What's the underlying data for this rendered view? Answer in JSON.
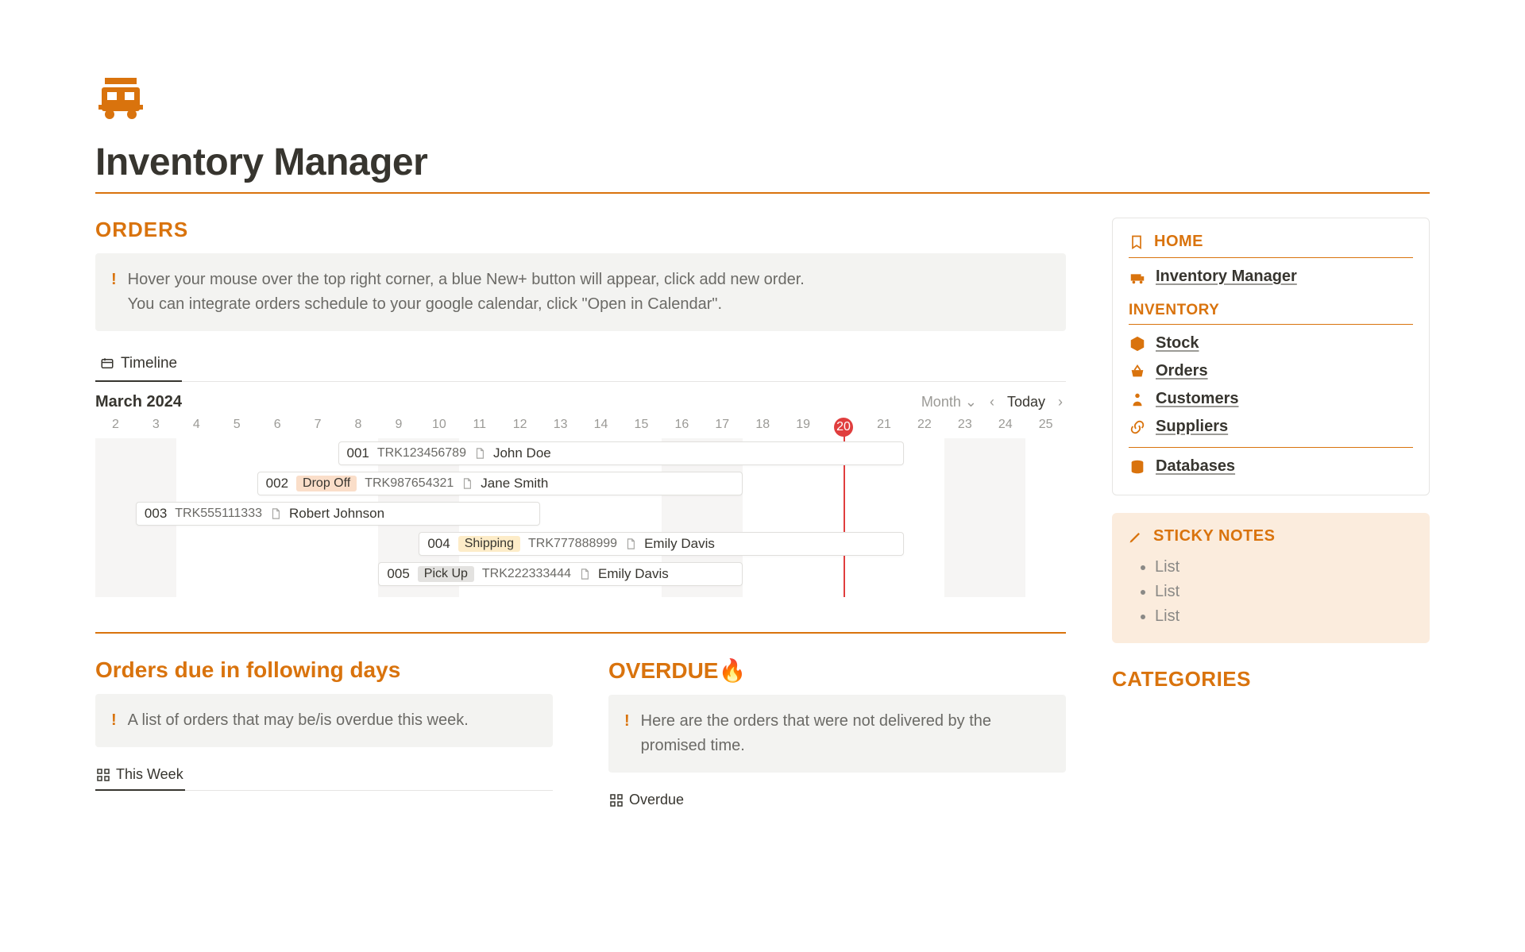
{
  "page": {
    "title": "Inventory Manager"
  },
  "orders": {
    "heading": "ORDERS",
    "callout_line1": "Hover your mouse over the top right corner, a blue New+ button will appear, click add new order.",
    "callout_line2": "You can integrate orders schedule to your google calendar, click \"Open in Calendar\".",
    "tab_label": "Timeline",
    "month_label": "March 2024",
    "scale_label": "Month",
    "today_label": "Today",
    "days": [
      "2",
      "3",
      "4",
      "5",
      "6",
      "7",
      "8",
      "9",
      "10",
      "11",
      "12",
      "13",
      "14",
      "15",
      "16",
      "17",
      "18",
      "19",
      "20",
      "21",
      "22",
      "23",
      "24",
      "25"
    ],
    "current_day_index": 18,
    "weekends": [
      [
        0,
        2
      ],
      [
        7,
        2
      ],
      [
        14,
        2
      ],
      [
        21,
        2
      ]
    ],
    "items": [
      {
        "id": "001",
        "tag": "",
        "trk": "TRK123456789",
        "customer": "John Doe",
        "start": 6,
        "span": 14
      },
      {
        "id": "002",
        "tag": "Drop Off",
        "tag_bg": "#fadec9",
        "trk": "TRK987654321",
        "customer": "Jane Smith",
        "start": 4,
        "span": 12
      },
      {
        "id": "003",
        "tag": "",
        "trk": "TRK555111333",
        "customer": "Robert Johnson",
        "start": 1,
        "span": 10
      },
      {
        "id": "004",
        "tag": "Shipping",
        "tag_bg": "#fdecc8",
        "trk": "TRK777888999",
        "customer": "Emily Davis",
        "start": 8,
        "span": 12
      },
      {
        "id": "005",
        "tag": "Pick Up",
        "tag_bg": "#e3e2e0",
        "trk": "TRK222333444",
        "customer": "Emily Davis",
        "start": 7,
        "span": 9
      }
    ]
  },
  "due": {
    "heading": "Orders due in following days",
    "callout": "A list of orders that may be/is overdue this week.",
    "tab": "This Week"
  },
  "overdue": {
    "heading": "OVERDUE🔥",
    "callout": "Here are the orders that were not delivered by the promised time.",
    "tab": "Overdue"
  },
  "side": {
    "home_label": "HOME",
    "home_link": "Inventory Manager",
    "inv_label": "INVENTORY",
    "links": {
      "stock": "Stock",
      "orders": "Orders",
      "customers": "Customers",
      "suppliers": "Suppliers",
      "databases": "Databases"
    },
    "sticky_label": "STICKY NOTES",
    "sticky_items": [
      "List",
      "List",
      "List"
    ],
    "categories_label": "CATEGORIES"
  }
}
